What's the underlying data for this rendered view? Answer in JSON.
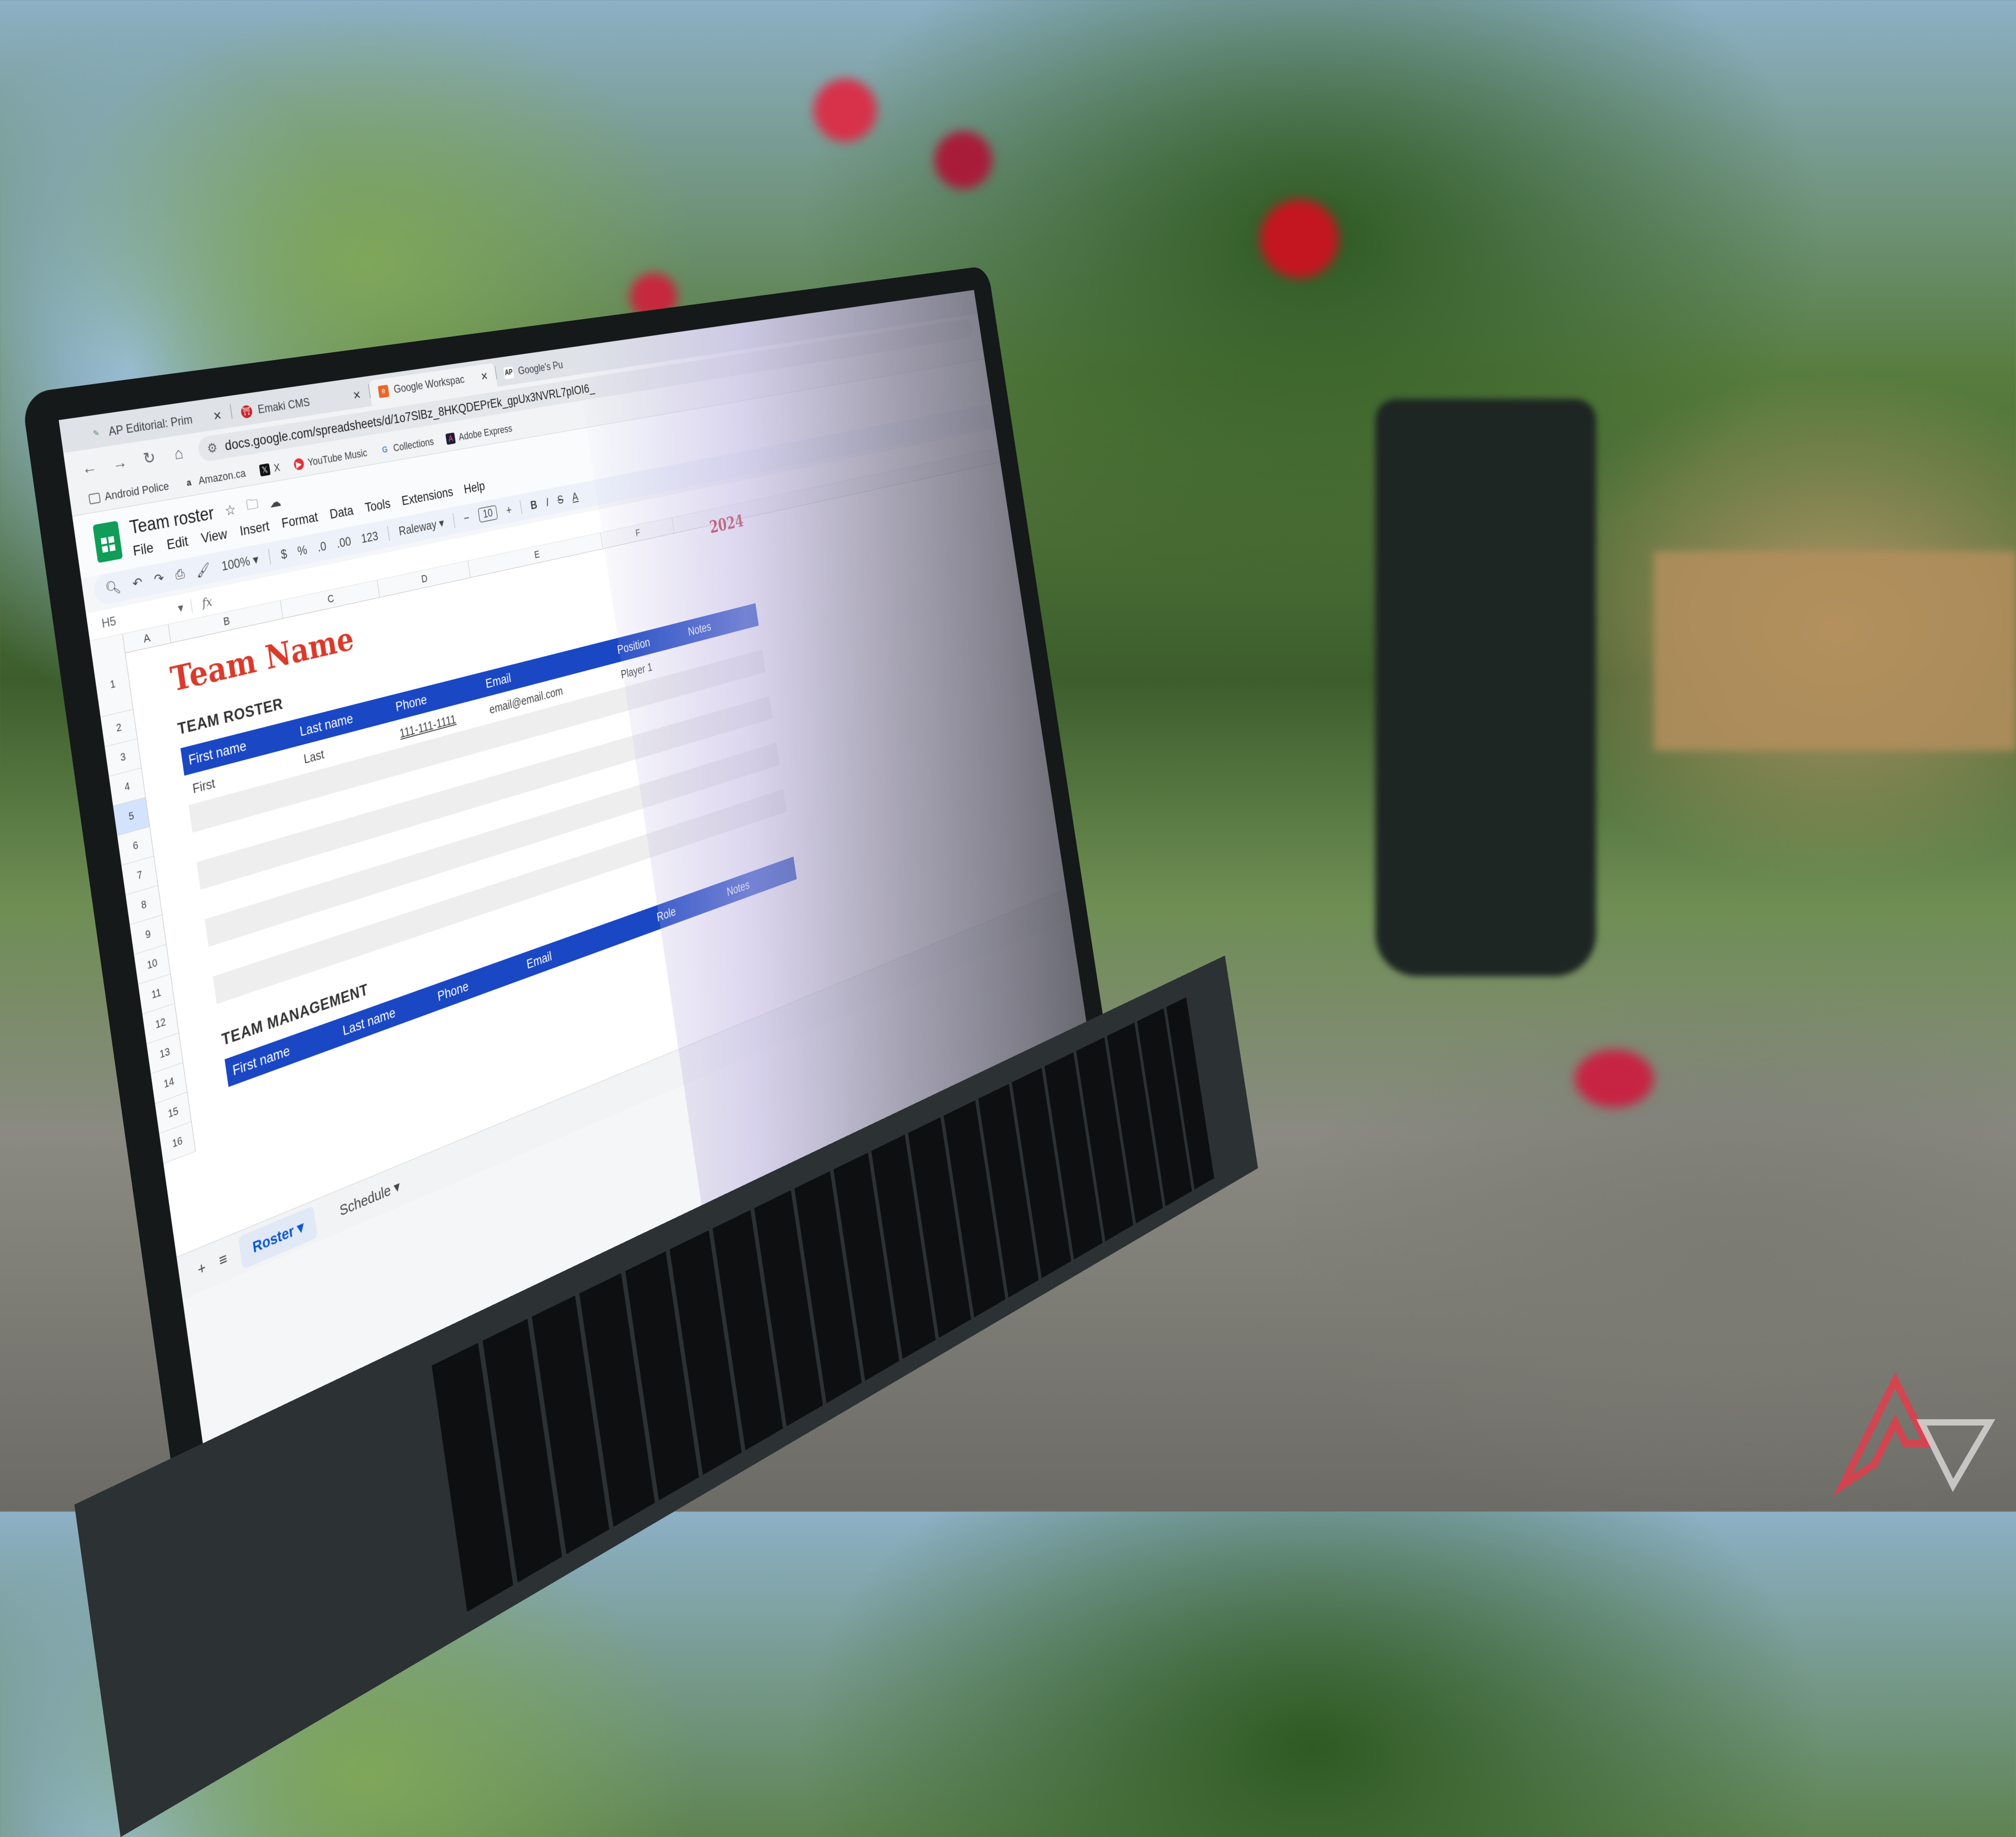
{
  "browser": {
    "tabs": [
      {
        "title": "AP Editorial: Prim",
        "icon": "pencil-icon",
        "active": false
      },
      {
        "title": "Emaki CMS",
        "icon": "emaki-icon",
        "active": false
      },
      {
        "title": "Google Workspac",
        "icon": "blogger-icon",
        "active": true
      },
      {
        "title": "Google's Pu",
        "icon": "ap-icon",
        "active": false
      }
    ],
    "close_glyph": "✕",
    "url": "docs.google.com/spreadsheets/d/1o7SlBz_8HKQDEPrEk_gpUx3NVRL7pIOI6_",
    "bookmarks": [
      {
        "label": "Android Police",
        "icon": "folder-icon"
      },
      {
        "label": "Amazon.ca",
        "icon": "amazon-icon"
      },
      {
        "label": "X",
        "icon": "x-icon"
      },
      {
        "label": "YouTube Music",
        "icon": "youtube-music-icon"
      },
      {
        "label": "Collections",
        "icon": "google-icon"
      },
      {
        "label": "Adobe Express",
        "icon": "adobe-express-icon"
      }
    ]
  },
  "sheets": {
    "doc_title": "Team roster",
    "menus": [
      "File",
      "Edit",
      "View",
      "Insert",
      "Format",
      "Data",
      "Tools",
      "Extensions",
      "Help"
    ],
    "toolbar": {
      "zoom": "100%",
      "currency": "$",
      "percent": "%",
      "dec_decrease": ".0",
      "dec_increase": ".00",
      "number_format": "123",
      "font": "Raleway",
      "font_size": "10",
      "minus": "−",
      "plus": "+",
      "bold": "B",
      "italic": "I"
    },
    "name_box": "H5",
    "fx": "fx",
    "columns": [
      "A",
      "B",
      "C",
      "D",
      "E",
      "F"
    ],
    "rows": [
      "1",
      "2",
      "3",
      "4",
      "5",
      "6",
      "7",
      "8",
      "9",
      "10",
      "11",
      "12",
      "13",
      "14",
      "15",
      "16"
    ],
    "selected_row": "5",
    "content": {
      "team_name": "Team Name",
      "year": "2024",
      "roster": {
        "title": "TEAM ROSTER",
        "headers": [
          "First name",
          "Last name",
          "Phone",
          "Email",
          "Position",
          "Notes"
        ],
        "rows": [
          [
            "First",
            "Last",
            "111-111-1111",
            "email@email.com",
            "Player 1",
            ""
          ]
        ]
      },
      "management": {
        "title": "TEAM MANAGEMENT",
        "headers": [
          "First name",
          "Last name",
          "Phone",
          "Email",
          "Role",
          "Notes"
        ]
      }
    },
    "sheet_tabs": [
      {
        "label": "Roster",
        "active": true
      },
      {
        "label": "Schedule",
        "active": false
      }
    ],
    "add_sheet": "+",
    "all_sheets": "≡"
  },
  "colors": {
    "header_blue": "#1a47c4",
    "title_red": "#d93a2b",
    "sheets_green": "#0f9d58"
  }
}
